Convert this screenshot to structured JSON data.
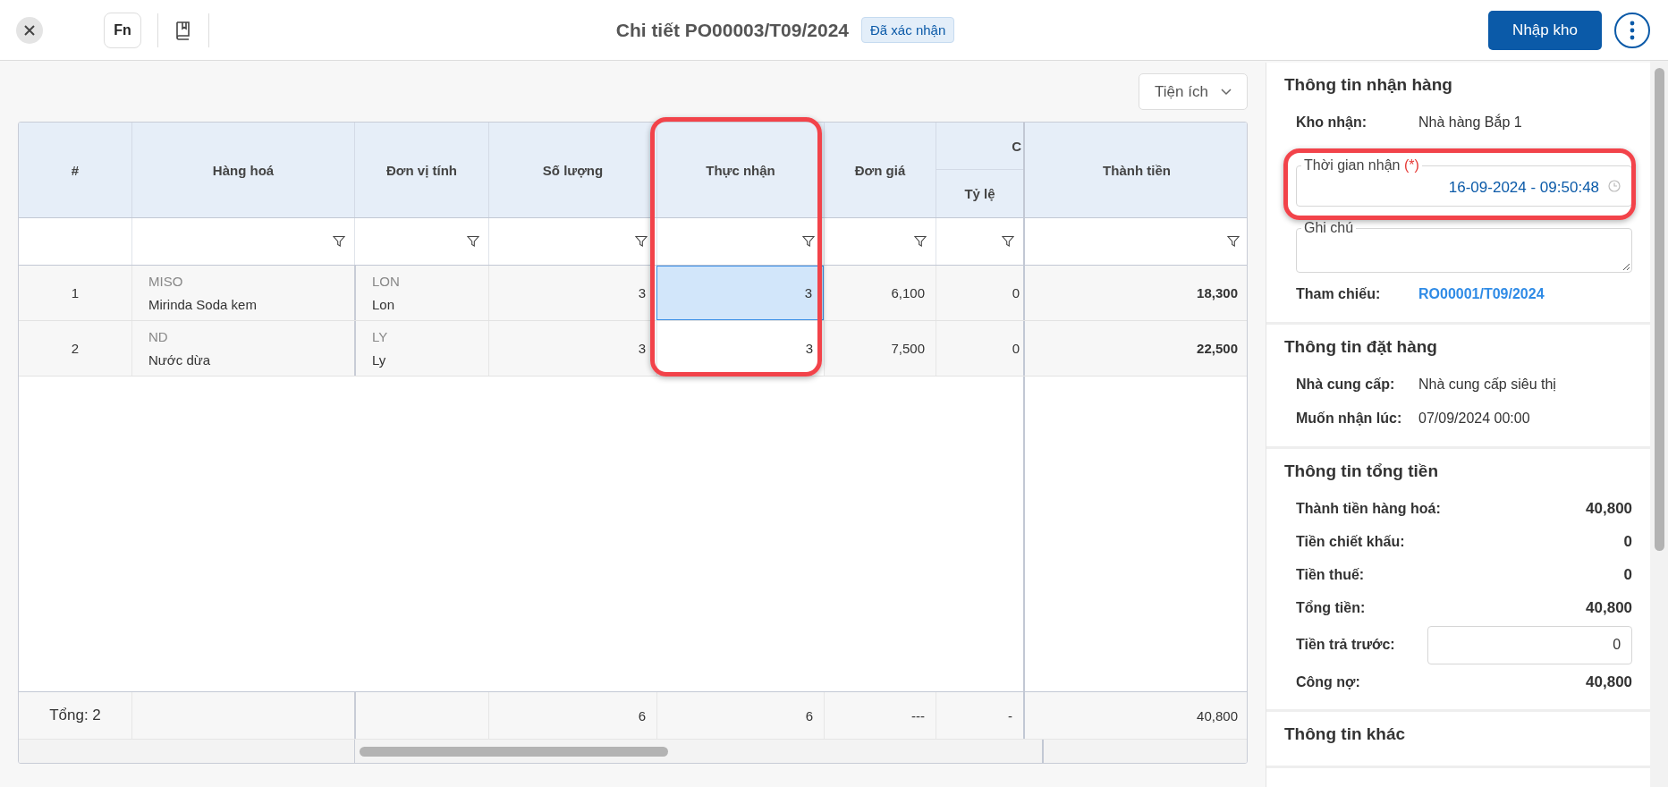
{
  "header": {
    "fn_label": "Fn",
    "title": "Chi tiết PO00003/T09/2024",
    "status": "Đã xác nhận",
    "primary_button": "Nhập kho"
  },
  "toolbar": {
    "utility_dropdown": "Tiện ích"
  },
  "table": {
    "columns": [
      {
        "label": "#",
        "filter": false
      },
      {
        "label": "Hàng hoá",
        "filter": true
      },
      {
        "label": "Đơn vị tính",
        "filter": true
      },
      {
        "label": "Số lượng",
        "filter": true
      },
      {
        "label": "Thực nhận",
        "filter": true
      },
      {
        "label": "Đơn giá",
        "filter": true
      },
      {
        "label": "Tỷ lệ",
        "group_label": "C",
        "filter": true
      },
      {
        "label": "Thành tiền",
        "filter": true
      }
    ],
    "rows": [
      {
        "index": "1",
        "code": "MISO",
        "name": "Mirinda Soda kem",
        "unit_code": "LON",
        "unit": "Lon",
        "quantity": "3",
        "received": "3",
        "received_focused": true,
        "price": "6,100",
        "rate": "0",
        "amount": "18,300"
      },
      {
        "index": "2",
        "code": "ND",
        "name": "Nước dừa",
        "unit_code": "LY",
        "unit": "Ly",
        "quantity": "3",
        "received": "3",
        "received_focused": false,
        "price": "7,500",
        "rate": "0",
        "amount": "22,500"
      }
    ],
    "footer": {
      "label": "Tổng: 2",
      "quantity": "6",
      "received": "6",
      "price": "---",
      "rate": "-",
      "amount": "40,800"
    }
  },
  "side_panel": {
    "sections": [
      {
        "title": "Thông tin nhận hàng",
        "fields": [
          {
            "kind": "text",
            "label": "Kho nhận:",
            "value": "Nhà hàng Bắp 1"
          },
          {
            "kind": "datetime",
            "label": "Thời gian nhận",
            "required_mark": "(*)",
            "value": "16-09-2024 - 09:50:48"
          },
          {
            "kind": "textarea",
            "label": "Ghi chú"
          },
          {
            "kind": "link",
            "label": "Tham chiếu:",
            "value": "RO00001/T09/2024"
          }
        ]
      },
      {
        "title": "Thông tin đặt hàng",
        "fields": [
          {
            "kind": "text",
            "label": "Nhà cung cấp:",
            "value": "Nhà cung cấp siêu thị"
          },
          {
            "kind": "text",
            "label": "Muốn nhận lúc:",
            "value": "07/09/2024 00:00"
          }
        ]
      },
      {
        "title": "Thông tin tổng tiền",
        "fields": [
          {
            "kind": "amount",
            "label": "Thành tiền hàng hoá:",
            "value": "40,800"
          },
          {
            "kind": "amount",
            "label": "Tiền chiết khấu:",
            "value": "0"
          },
          {
            "kind": "amount",
            "label": "Tiền thuế:",
            "value": "0"
          },
          {
            "kind": "amount",
            "label": "Tổng tiền:",
            "value": "40,800"
          },
          {
            "kind": "input",
            "label": "Tiền trả trước:",
            "value": "0"
          },
          {
            "kind": "amount",
            "label": "Công nợ:",
            "value": "40,800"
          }
        ]
      },
      {
        "title": "Thông tin khác"
      }
    ]
  }
}
